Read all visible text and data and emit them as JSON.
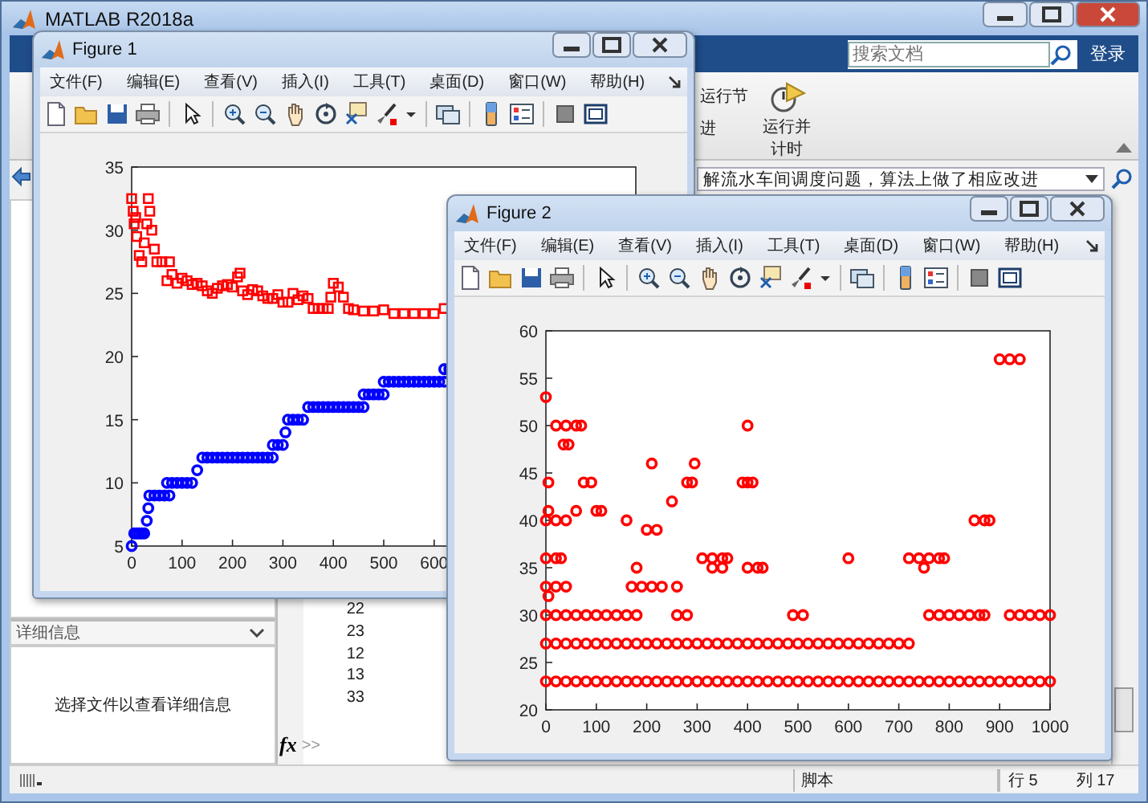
{
  "window": {
    "title": "MATLAB R2018a"
  },
  "search": {
    "placeholder": "搜索文档"
  },
  "login_button": "登录",
  "toolstrip": [
    {
      "kind": "small",
      "label": "运行节"
    },
    {
      "kind": "text",
      "label": "进"
    },
    {
      "kind": "large",
      "label": "运行并计时"
    }
  ],
  "address": "解流水车间调度问题，算法上做了相应改进",
  "details_panel": {
    "title": "详细信息",
    "message": "选择文件以查看详细信息"
  },
  "command_window": {
    "lines": [
      "22",
      "23",
      "12",
      "13",
      "33"
    ],
    "fx_button": "fx",
    "prompt": ">>"
  },
  "status_bar": {
    "mode": "脚本",
    "line": "行 5",
    "column": "列 17"
  },
  "figures": [
    {
      "title": "Figure 1",
      "menu": [
        "文件(F)",
        "编辑(E)",
        "查看(V)",
        "插入(I)",
        "工具(T)",
        "桌面(D)",
        "窗口(W)",
        "帮助(H)"
      ],
      "chart_data": {
        "type": "scatter",
        "xlim": [
          0,
          1000
        ],
        "ylim": [
          5,
          35
        ],
        "xticks": [
          0,
          100,
          200,
          300,
          400,
          500,
          600
        ],
        "yticks": [
          5,
          10,
          15,
          20,
          25,
          30,
          35
        ],
        "series": [
          {
            "color": "#ff0000",
            "marker": "square",
            "x": [
              0,
              3,
              5,
              8,
              10,
              15,
              20,
              25,
              30,
              33,
              36,
              40,
              45,
              50,
              60,
              70,
              75,
              80,
              90,
              100,
              110,
              120,
              130,
              140,
              150,
              160,
              170,
              180,
              190,
              200,
              210,
              215,
              220,
              230,
              240,
              250,
              260,
              270,
              280,
              290,
              300,
              310,
              320,
              330,
              340,
              350,
              360,
              370,
              380,
              390,
              395,
              400,
              410,
              420,
              430,
              440,
              460,
              480,
              500,
              520,
              540,
              560,
              580,
              600,
              620
            ],
            "values": [
              32.5,
              31.5,
              30.5,
              31,
              29.5,
              28,
              27.5,
              29,
              30.5,
              32.5,
              31.5,
              30,
              28.5,
              27.5,
              27.5,
              26,
              27.5,
              26.5,
              25.8,
              26.2,
              26,
              25.7,
              25.8,
              25.6,
              25.2,
              25.0,
              25.4,
              25.6,
              25.7,
              25.5,
              26.3,
              26.6,
              25.2,
              24.9,
              25.3,
              25.2,
              24.8,
              24.6,
              24.6,
              24.9,
              24.3,
              24.3,
              25,
              24.5,
              24.8,
              24.6,
              23.8,
              23.8,
              23.8,
              23.8,
              24.7,
              25.8,
              25.5,
              24.7,
              23.8,
              23.7,
              23.6,
              23.6,
              23.7,
              23.4,
              23.4,
              23.4,
              23.4,
              23.4,
              23.8
            ]
          },
          {
            "color": "#0000ff",
            "marker": "circle",
            "x": [
              0,
              5,
              10,
              15,
              20,
              25,
              30,
              33,
              35,
              45,
              55,
              65,
              75,
              70,
              80,
              90,
              100,
              110,
              120,
              130,
              140,
              150,
              160,
              170,
              180,
              190,
              200,
              210,
              220,
              230,
              240,
              250,
              260,
              270,
              280,
              280,
              290,
              300,
              305,
              310,
              320,
              330,
              340,
              350,
              360,
              370,
              380,
              390,
              400,
              410,
              420,
              430,
              440,
              450,
              460,
              460,
              470,
              480,
              490,
              500,
              500,
              510,
              520,
              530,
              540,
              550,
              560,
              570,
              580,
              590,
              600,
              610,
              620,
              620,
              630
            ],
            "values": [
              5,
              6,
              6,
              6,
              6,
              6,
              7,
              8,
              9,
              9,
              9,
              9,
              9,
              10,
              10,
              10,
              10,
              10,
              10,
              11,
              12,
              12,
              12,
              12,
              12,
              12,
              12,
              12,
              12,
              12,
              12,
              12,
              12,
              12,
              12,
              13,
              13,
              13,
              14,
              15,
              15,
              15,
              15,
              16,
              16,
              16,
              16,
              16,
              16,
              16,
              16,
              16,
              16,
              16,
              16,
              17,
              17,
              17,
              17,
              17,
              18,
              18,
              18,
              18,
              18,
              18,
              18,
              18,
              18,
              18,
              18,
              18,
              18,
              19,
              19
            ]
          }
        ]
      }
    },
    {
      "title": "Figure 2",
      "menu": [
        "文件(F)",
        "编辑(E)",
        "查看(V)",
        "插入(I)",
        "工具(T)",
        "桌面(D)",
        "窗口(W)",
        "帮助(H)"
      ],
      "chart_data": {
        "type": "scatter",
        "xlim": [
          0,
          1000
        ],
        "ylim": [
          20,
          60
        ],
        "xticks": [
          0,
          100,
          200,
          300,
          400,
          500,
          600,
          700,
          800,
          900,
          1000
        ],
        "yticks": [
          20,
          25,
          30,
          35,
          40,
          45,
          50,
          55,
          60
        ],
        "series": [
          {
            "color": "#ff0000",
            "marker": "circle",
            "x": [
              0,
              20,
              40,
              60,
              80,
              100,
              120,
              140,
              160,
              180,
              200,
              220,
              240,
              260,
              280,
              300,
              320,
              340,
              360,
              380,
              400,
              420,
              440,
              460,
              480,
              500,
              520,
              540,
              560,
              580,
              600,
              620,
              640,
              660,
              680,
              700,
              720,
              740,
              760,
              780,
              800,
              820,
              840,
              860,
              880,
              900,
              920,
              940,
              960,
              980,
              1000,
              0,
              20,
              40,
              60,
              80,
              100,
              120,
              140,
              160,
              180,
              200,
              220,
              240,
              260,
              280,
              300,
              320,
              340,
              360,
              380,
              400,
              420,
              440,
              460,
              480,
              500,
              520,
              540,
              560,
              580,
              600,
              620,
              640,
              660,
              680,
              700,
              720,
              0,
              20,
              40,
              60,
              80,
              100,
              120,
              140,
              160,
              180,
              260,
              280,
              490,
              510,
              760,
              780,
              800,
              820,
              840,
              860,
              870,
              920,
              940,
              960,
              980,
              1000,
              5,
              0,
              20,
              40,
              170,
              190,
              210,
              230,
              260,
              180,
              330,
              350,
              400,
              420,
              430,
              750,
              0,
              20,
              30,
              310,
              330,
              350,
              360,
              600,
              720,
              740,
              760,
              780,
              790,
              200,
              220,
              0,
              20,
              40,
              160,
              850,
              870,
              880,
              5,
              60,
              100,
              110,
              250,
              5,
              75,
              90,
              280,
              290,
              390,
              400,
              410,
              210,
              295,
              35,
              45,
              20,
              40,
              60,
              70,
              400,
              0,
              900,
              920,
              940
            ],
            "values": [
              23,
              23,
              23,
              23,
              23,
              23,
              23,
              23,
              23,
              23,
              23,
              23,
              23,
              23,
              23,
              23,
              23,
              23,
              23,
              23,
              23,
              23,
              23,
              23,
              23,
              23,
              23,
              23,
              23,
              23,
              23,
              23,
              23,
              23,
              23,
              23,
              23,
              23,
              23,
              23,
              23,
              23,
              23,
              23,
              23,
              23,
              23,
              23,
              23,
              23,
              23,
              27,
              27,
              27,
              27,
              27,
              27,
              27,
              27,
              27,
              27,
              27,
              27,
              27,
              27,
              27,
              27,
              27,
              27,
              27,
              27,
              27,
              27,
              27,
              27,
              27,
              27,
              27,
              27,
              27,
              27,
              27,
              27,
              27,
              27,
              27,
              27,
              27,
              30,
              30,
              30,
              30,
              30,
              30,
              30,
              30,
              30,
              30,
              30,
              30,
              30,
              30,
              30,
              30,
              30,
              30,
              30,
              30,
              30,
              30,
              30,
              30,
              30,
              30,
              32,
              33,
              33,
              33,
              33,
              33,
              33,
              33,
              33,
              35,
              35,
              35,
              35,
              35,
              35,
              35,
              36,
              36,
              36,
              36,
              36,
              36,
              36,
              36,
              36,
              36,
              36,
              36,
              36,
              39,
              39,
              40,
              40,
              40,
              40,
              40,
              40,
              40,
              41,
              41,
              41,
              41,
              42,
              44,
              44,
              44,
              44,
              44,
              44,
              44,
              44,
              46,
              46,
              48,
              48,
              50,
              50,
              50,
              50,
              50,
              53,
              57,
              57,
              57
            ]
          }
        ]
      }
    }
  ]
}
